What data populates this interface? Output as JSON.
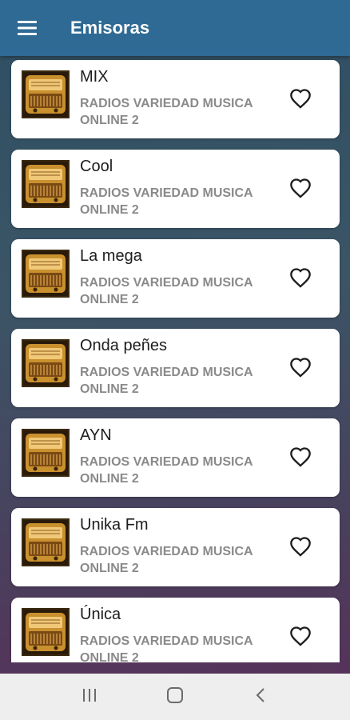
{
  "app": {
    "title": "Emisoras"
  },
  "stations": [
    {
      "name": "MIX",
      "subtitle": "RADIOS VARIEDAD MUSICA ONLINE 2"
    },
    {
      "name": "Cool",
      "subtitle": "RADIOS VARIEDAD MUSICA ONLINE 2"
    },
    {
      "name": "La mega",
      "subtitle": "RADIOS VARIEDAD MUSICA ONLINE 2"
    },
    {
      "name": "Onda peñes",
      "subtitle": "RADIOS VARIEDAD MUSICA ONLINE 2"
    },
    {
      "name": "AYN",
      "subtitle": "RADIOS VARIEDAD MUSICA ONLINE 2"
    },
    {
      "name": "Unika Fm",
      "subtitle": "RADIOS VARIEDAD MUSICA ONLINE 2"
    },
    {
      "name": "Única",
      "subtitle": "RADIOS VARIEDAD MUSICA ONLINE 2"
    }
  ],
  "icons": {
    "menu": "hamburger-menu-icon",
    "favorite": "heart-outline-icon",
    "thumbnail": "vintage-radio-icon",
    "nav_recents": "recent-apps-icon",
    "nav_home": "home-icon",
    "nav_back": "back-chevron-icon"
  },
  "colors": {
    "appbar": "#2f6a94",
    "card": "#ffffff",
    "title_text": "#1d1d1d",
    "subtitle_text": "#8a8a8a",
    "navbar": "#eeeeef"
  }
}
